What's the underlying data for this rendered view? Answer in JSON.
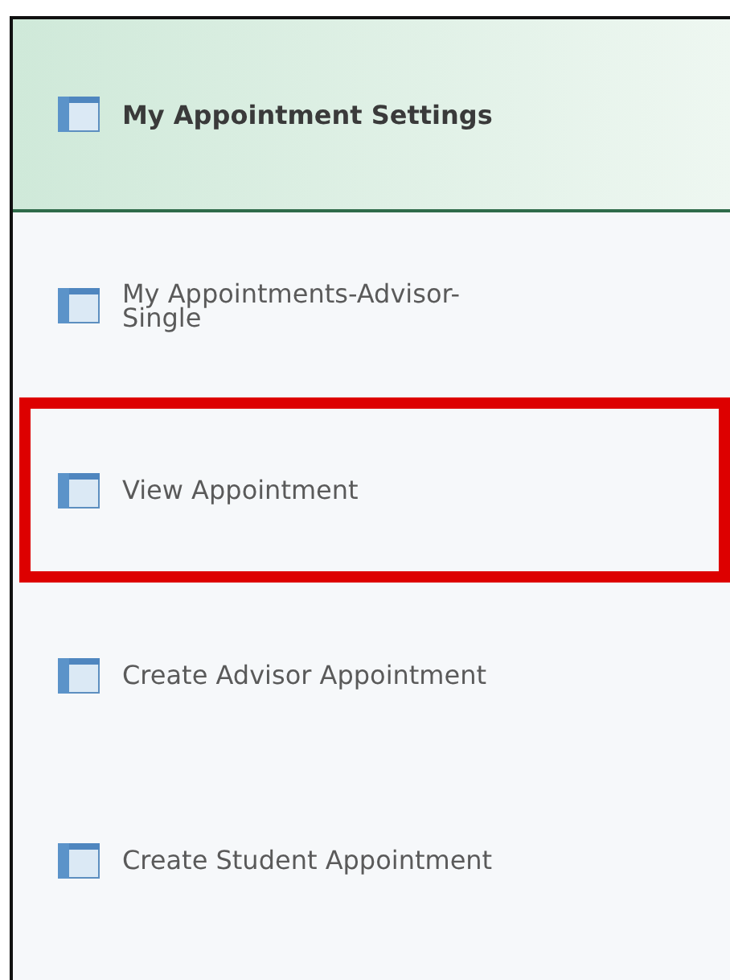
{
  "menu": {
    "items": [
      {
        "label": "My Appointment Settings",
        "selected": true,
        "highlighted": false
      },
      {
        "label": "My Appointments-Advisor-Single",
        "selected": false,
        "highlighted": false
      },
      {
        "label": "View Appointment",
        "selected": false,
        "highlighted": true
      },
      {
        "label": "Create Advisor Appointment",
        "selected": false,
        "highlighted": false
      },
      {
        "label": "Create Student Appointment",
        "selected": false,
        "highlighted": false
      }
    ]
  }
}
